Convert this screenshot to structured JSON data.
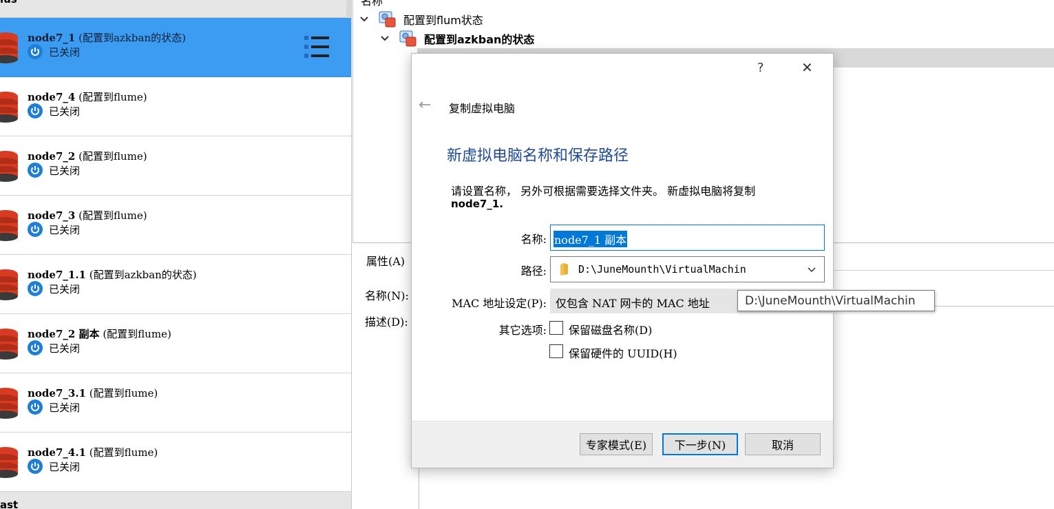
{
  "vm_list": {
    "top_group": "lus",
    "bottom_group": "ast",
    "items": [
      {
        "name": "node7_1",
        "snapshot": "(配置到azkban的状态)",
        "state": "已关闭",
        "selected": true
      },
      {
        "name": "node7_4",
        "snapshot": "(配置到flume)",
        "state": "已关闭"
      },
      {
        "name": "node7_2",
        "snapshot": "(配置到flume)",
        "state": "已关闭"
      },
      {
        "name": "node7_3",
        "snapshot": "(配置到flume)",
        "state": "已关闭"
      },
      {
        "name": "node7_1.1",
        "snapshot": "(配置到azkban的状态)",
        "state": "已关闭"
      },
      {
        "name": "node7_2 副本",
        "snapshot": "(配置到flume)",
        "state": "已关闭"
      },
      {
        "name": "node7_3.1",
        "snapshot": "(配置到flume)",
        "state": "已关闭"
      },
      {
        "name": "node7_4.1",
        "snapshot": "(配置到flume)",
        "state": "已关闭"
      }
    ]
  },
  "snapshot_tree": {
    "header": "名称",
    "rows": [
      {
        "label": "配置到flum状态"
      },
      {
        "label": "配置到azkban的状态"
      }
    ]
  },
  "properties": {
    "tab_label": "属性(A)",
    "name_label": "名称(N):",
    "desc_label": "描述(D):"
  },
  "dialog": {
    "help_glyph": "?",
    "close_glyph": "✕",
    "back_glyph": "←",
    "wizard_title": "复制虚拟电脑",
    "heading": "新虚拟电脑名称和保存路径",
    "description_line1": "请设置名称， 另外可根据需要选择文件夹。 新虚拟电脑将复制",
    "description_line2": "node7_1.",
    "name_label": "名称:",
    "name_value": "node7_1 副本",
    "path_label": "路径:",
    "path_value": "D:\\JuneMounth\\VirtualMachin",
    "mac_label": "MAC 地址设定(P):",
    "mac_value": "仅包含 NAT 网卡的 MAC 地址",
    "other_label": "其它选项:",
    "opt_keep_disk": "保留磁盘名称(D)",
    "opt_keep_uuid": "保留硬件的 UUID(H)",
    "btn_expert": "专家模式(E)",
    "btn_next": "下一步(N)",
    "btn_cancel": "取消"
  },
  "tooltip": {
    "text": "D:\\JuneMounth\\VirtualMachin"
  },
  "colors": {
    "selected_bg": "#3c9cf2",
    "accent": "#0078d7",
    "heading_blue": "#1e4a9a",
    "power_blue": "#1f7fd6",
    "vm_red": "#d93a22"
  }
}
